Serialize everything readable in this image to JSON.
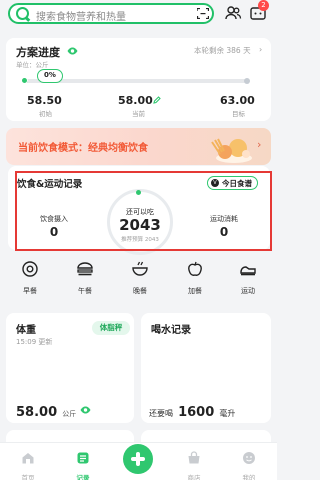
{
  "search": {
    "placeholder": "搜索食物营养和热量"
  },
  "header": {
    "notifications": "2"
  },
  "plan": {
    "title": "方案进度",
    "unit": "单位：公斤",
    "remaining": "本轮剩余 386 天",
    "progress_label": "0%",
    "progress": 0.0,
    "start_value": "58.50",
    "start_label": "初始",
    "current_value": "58.00",
    "current_label": "当前",
    "target_value": "63.00",
    "target_label": "目标"
  },
  "mode_banner": {
    "text": "当前饮食模式：经典均衡饮食"
  },
  "diet": {
    "title": "饮食&运动记录",
    "today_button": "今日食谱",
    "intake_label": "饮食摄入",
    "intake_value": "0",
    "can_eat_label": "还可以吃",
    "can_eat_value": "2043",
    "recommend_label": "推荐预算 2043",
    "exercise_label": "运动消耗",
    "exercise_value": "0"
  },
  "meals": [
    {
      "label": "早餐",
      "icon": "breakfast-icon"
    },
    {
      "label": "午餐",
      "icon": "lunch-icon"
    },
    {
      "label": "晚餐",
      "icon": "dinner-icon"
    },
    {
      "label": "加餐",
      "icon": "snack-icon"
    },
    {
      "label": "运动",
      "icon": "sport-icon"
    }
  ],
  "weight_card": {
    "title": "体重",
    "button": "体脂秤",
    "updated": "15:09 更新",
    "value": "58.00",
    "unit": "公斤"
  },
  "water_card": {
    "title": "喝水记录",
    "prefix": "还要喝",
    "value": "1600",
    "unit": "毫升"
  },
  "tabs": [
    {
      "label": "首页",
      "icon": "home-icon",
      "active": false
    },
    {
      "label": "记录",
      "icon": "record-icon",
      "active": true
    },
    {
      "label": "商店",
      "icon": "shop-icon",
      "active": false
    },
    {
      "label": "我的",
      "icon": "profile-icon",
      "active": false
    }
  ],
  "colors": {
    "accent": "#2fc76f",
    "banner_text": "#f25a37",
    "highlight_border": "#e53935"
  }
}
